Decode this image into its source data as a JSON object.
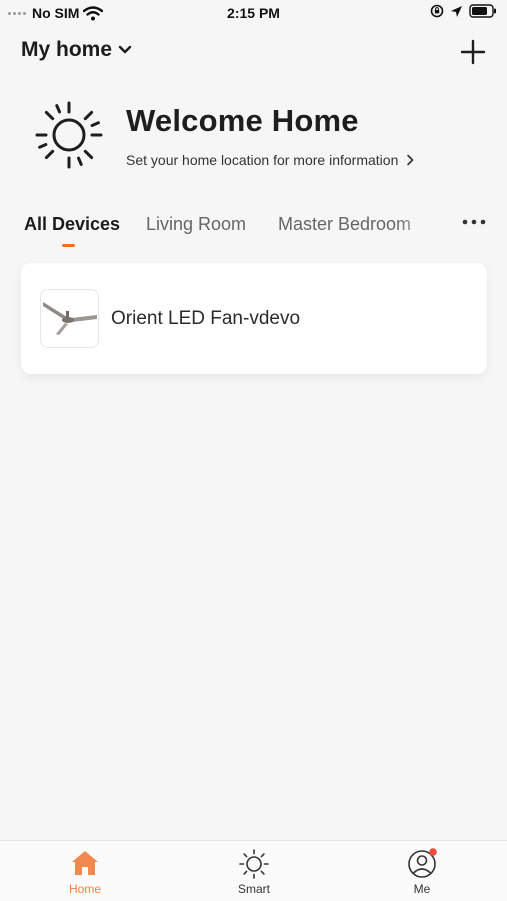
{
  "status_bar": {
    "carrier": "No SIM",
    "time": "2:15 PM"
  },
  "header": {
    "home_name": "My home"
  },
  "welcome": {
    "title": "Welcome Home",
    "subtitle": "Set your home location for more information"
  },
  "tabs": [
    {
      "label": "All Devices",
      "active": true
    },
    {
      "label": "Living Room",
      "active": false
    },
    {
      "label": "Master Bedroom",
      "active": false
    }
  ],
  "devices": [
    {
      "name": "Orient LED Fan-vdevo",
      "icon": "ceiling-fan-icon"
    }
  ],
  "bottom_nav": [
    {
      "label": "Home",
      "icon": "home-icon",
      "active": true
    },
    {
      "label": "Smart",
      "icon": "sun-icon",
      "active": false
    },
    {
      "label": "Me",
      "icon": "profile-icon",
      "active": false,
      "notification": true
    }
  ],
  "colors": {
    "accent": "#ff6b1a",
    "nav_active": "#ff7d3b",
    "badge": "#f04a3a",
    "background": "#f6f6f6"
  }
}
